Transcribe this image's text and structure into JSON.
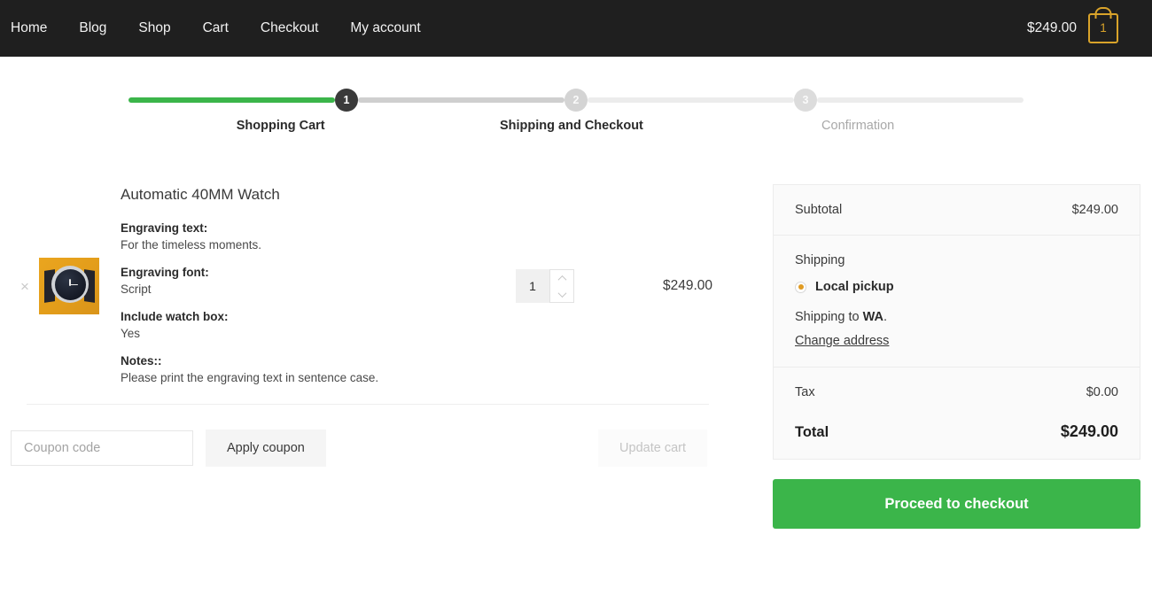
{
  "nav": {
    "links": [
      {
        "label": "Home"
      },
      {
        "label": "Blog"
      },
      {
        "label": "Shop"
      },
      {
        "label": "Cart"
      },
      {
        "label": "Checkout"
      },
      {
        "label": "My account"
      }
    ],
    "cart_total": "$249.00",
    "cart_count": "1",
    "cart_icon": "shopping-bag-icon",
    "accent_gold": "#d9a32a"
  },
  "stepper": {
    "steps": [
      {
        "number": "1",
        "label": "Shopping Cart",
        "state": "active"
      },
      {
        "number": "2",
        "label": "Shipping and Checkout",
        "state": "upcoming"
      },
      {
        "number": "3",
        "label": "Confirmation",
        "state": "upcoming"
      }
    ],
    "progress_color": "#3bb54a"
  },
  "cart": {
    "remove_label": "×",
    "item": {
      "title": "Automatic 40MM Watch",
      "thumb_alt": "watch-thumbnail",
      "meta": [
        {
          "key": "Engraving text:",
          "value": "For the timeless moments."
        },
        {
          "key": "Engraving font:",
          "value": "Script"
        },
        {
          "key": "Include watch box:",
          "value": "Yes"
        },
        {
          "key": "Notes::",
          "value": "Please print the engraving text in sentence case."
        }
      ],
      "quantity": "1",
      "price": "$249.00"
    },
    "coupon_placeholder": "Coupon code",
    "coupon_value": "",
    "apply_coupon_label": "Apply coupon",
    "update_cart_label": "Update cart"
  },
  "summary": {
    "subtotal_label": "Subtotal",
    "subtotal_value": "$249.00",
    "shipping_label": "Shipping",
    "shipping_option": "Local pickup",
    "shipping_radio_color": "#e09b23",
    "shipping_to_prefix": "Shipping to ",
    "shipping_to_region": "WA",
    "shipping_to_suffix": ".",
    "change_address_label": "Change address",
    "tax_label": "Tax",
    "tax_value": "$0.00",
    "total_label": "Total",
    "total_value": "$249.00",
    "checkout_label": "Proceed to checkout",
    "checkout_color": "#3bb54a"
  }
}
